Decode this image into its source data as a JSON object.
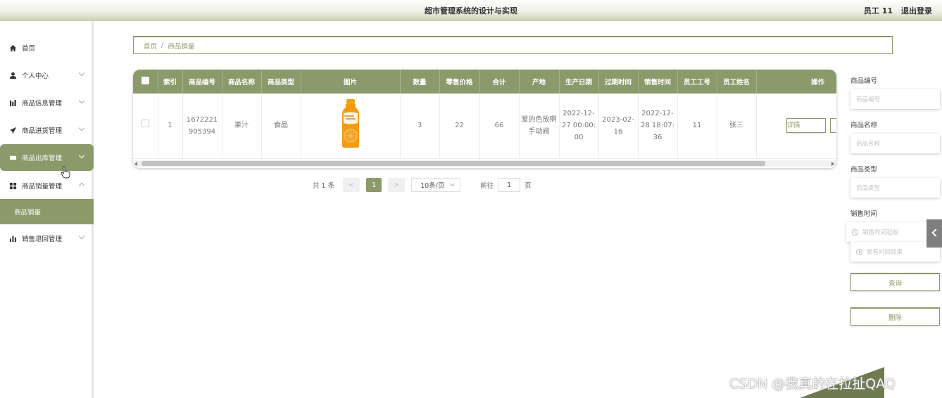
{
  "header": {
    "title": "超市管理系统的设计与实现",
    "user": "员工 11",
    "logout": "退出登录"
  },
  "sidebar": {
    "items": [
      {
        "label": "首页",
        "icon": "home-icon"
      },
      {
        "label": "个人中心",
        "icon": "user-icon"
      },
      {
        "label": "商品信息管理",
        "icon": "chart-icon"
      },
      {
        "label": "商品进货管理",
        "icon": "send-icon"
      },
      {
        "label": "商品出库管理",
        "icon": "ticket-icon"
      },
      {
        "label": "商品销量管理",
        "icon": "grid-icon"
      },
      {
        "label": "销售退回管理",
        "icon": "bar-chart-icon"
      }
    ],
    "sub_item": "商品销量"
  },
  "breadcrumb": {
    "home": "首页",
    "sep": "/",
    "current": "商品销量"
  },
  "table": {
    "columns": [
      "索引",
      "商品编号",
      "商品名称",
      "商品类型",
      "图片",
      "数量",
      "零售价格",
      "合计",
      "产地",
      "生产日期",
      "过期时间",
      "销售时间",
      "员工工号",
      "员工姓名",
      "操作"
    ],
    "rows": [
      {
        "index": "1",
        "code": "1672221905394",
        "name": "果汁",
        "type": "食品",
        "qty": "3",
        "price": "22",
        "total": "66",
        "origin": "爱的色放啊手动阀",
        "produced": "2022-12-27 00:00:00",
        "expires": "2023-02-16",
        "sold": "2022-12-28 18:07:36",
        "emp_id": "11",
        "emp_name": "张三",
        "detail_label": "详情"
      }
    ]
  },
  "pagination": {
    "total": "共 1 条",
    "prev": "<",
    "current": "1",
    "next": ">",
    "page_size": "10条/页",
    "goto_label": "前往",
    "goto_value": "1",
    "page_suffix": "页"
  },
  "filters": {
    "code_label": "商品编号",
    "code_placeholder": "商品编号",
    "name_label": "商品名称",
    "name_placeholder": "商品名称",
    "type_label": "商品类型",
    "type_placeholder": "商品类型",
    "time_label": "销售时间",
    "time_start": "销售时间起始",
    "time_end": "销售时间结束",
    "query": "查询",
    "delete": "删除"
  },
  "watermark": "CSDN @我真的在拉扯QAQ",
  "colors": {
    "accent": "#8a9a6a",
    "header_gradient_end": "#c9cfb4"
  }
}
